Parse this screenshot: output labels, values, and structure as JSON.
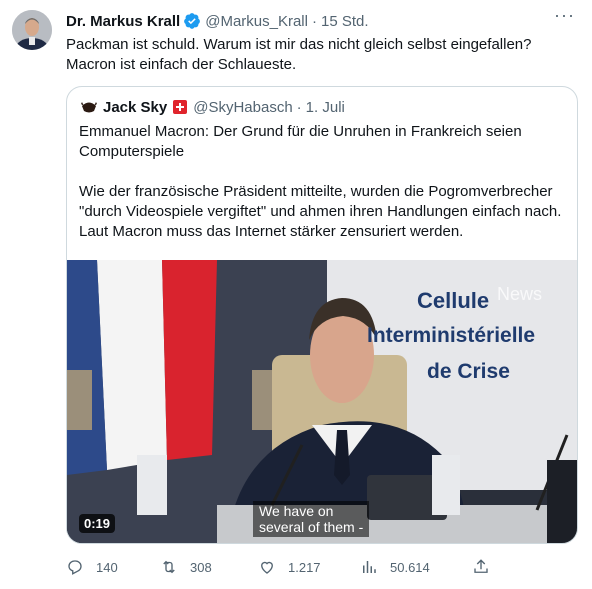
{
  "tweet": {
    "author_name": "Dr. Markus Krall",
    "handle": "@Markus_Krall",
    "time": "15 Std.",
    "text_line1": "Packman ist schuld. Warum ist mir das nicht gleich selbst eingefallen?",
    "text_line2": "Macron ist einfach der Schlaueste."
  },
  "quote": {
    "author_name": "Jack Sky",
    "handle": "@SkyHabasch",
    "date": "1. Juli",
    "paragraph1": "Emmanuel Macron: Der Grund für die Unruhen in Frankreich seien Computerspiele",
    "paragraph2": "Wie der französische Präsident mitteilte, wurden die Pogromverbrecher \"durch Videospiele vergiftet\" und ahmen ihren Handlungen einfach nach. Laut Macron muss das Internet stärker zensuriert werden."
  },
  "video": {
    "duration": "0:19",
    "subtitle_line1": "We have on",
    "subtitle_line2": "several of them -",
    "banner_line1": "Cellule",
    "banner_line2": "Interministérielle",
    "banner_line3": "de Crise",
    "watermark": "News"
  },
  "actions": {
    "replies": "140",
    "retweets": "308",
    "likes": "1.217",
    "views": "50.614"
  },
  "colors": {
    "text": "#0f1419",
    "muted": "#536471",
    "verified_blue": "#1d9bf0",
    "border": "#cfd9de",
    "flag_red": "#e0242c"
  }
}
